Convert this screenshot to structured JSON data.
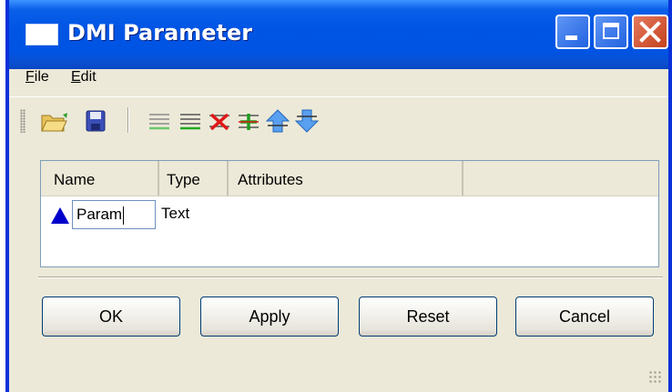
{
  "window": {
    "title": "DMI Parameter",
    "colors": {
      "title_bar": "#0054e3",
      "frame": "#0831d9",
      "face": "#ece9d8",
      "close_button": "#c4421d"
    }
  },
  "menu": {
    "items": [
      {
        "mnemonic": "F",
        "rest": "ile"
      },
      {
        "mnemonic": "E",
        "rest": "dit"
      }
    ]
  },
  "toolbar": {
    "icons": [
      "open-folder-icon",
      "save-icon",
      "list-icon",
      "add-item-icon",
      "delete-item-icon",
      "insert-item-icon",
      "move-up-icon",
      "move-down-icon"
    ]
  },
  "table": {
    "columns": [
      "Name",
      "Type",
      "Attributes"
    ],
    "rows": [
      {
        "icon": "blue-triangle-icon",
        "name": "Param",
        "type": "Text",
        "attributes": ""
      }
    ]
  },
  "buttons": {
    "ok": "OK",
    "apply": "Apply",
    "reset": "Reset",
    "cancel": "Cancel"
  }
}
